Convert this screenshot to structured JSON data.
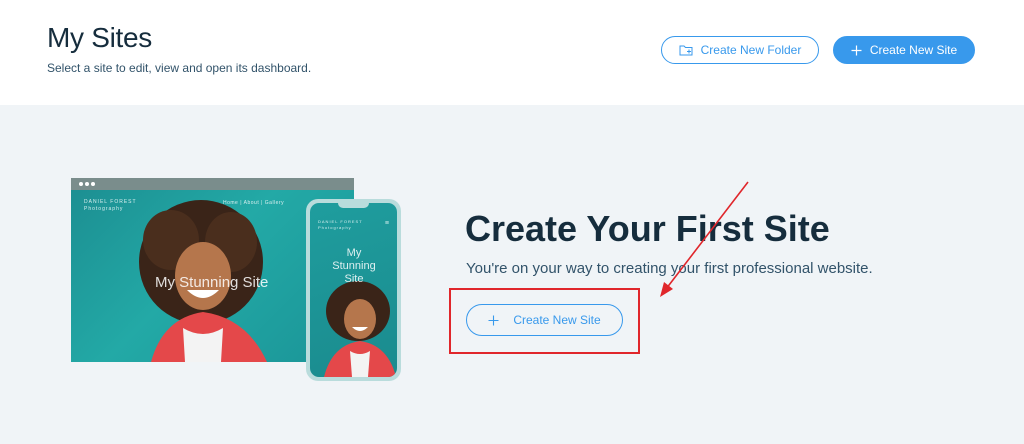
{
  "header": {
    "title": "My Sites",
    "subtitle": "Select a site to edit, view and open its dashboard.",
    "create_folder_label": "Create New Folder",
    "create_site_label": "Create New Site"
  },
  "preview": {
    "desktop_brand": "DANIEL FOREST",
    "desktop_brand_sub": "Photography",
    "desktop_nav": "Home  |  About  |  Gallery",
    "desktop_site_title": "My Stunning Site",
    "phone_brand": "DANIEL FOREST",
    "phone_brand_sub": "Photography",
    "phone_site_title": "My Stunning Site"
  },
  "hero": {
    "title": "Create Your First Site",
    "subtitle": "You're on your way to creating your first professional website.",
    "button_label": "Create New Site"
  },
  "colors": {
    "accent": "#3899ec",
    "title_text": "#162d3d",
    "background": "#f0f4f7",
    "annotation": "#e0262b"
  },
  "icons": {
    "folder": "folder-plus-icon",
    "plus": "plus-icon",
    "phone_menu": "hamburger-menu-icon"
  }
}
